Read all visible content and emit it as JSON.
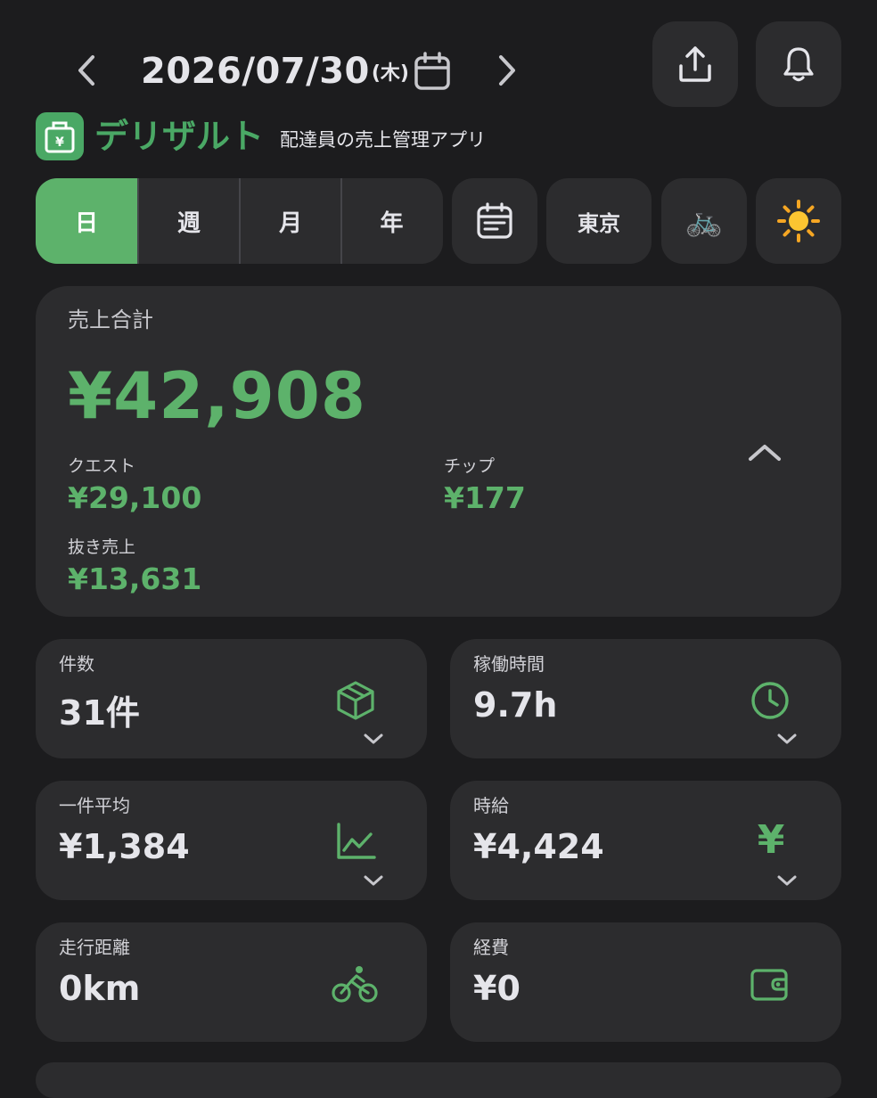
{
  "header": {
    "date": "2026/07/30",
    "weekday": "(木)"
  },
  "brand": {
    "name": "デリザルト",
    "subtitle": "配達員の売上管理アプリ",
    "logo_glyph": "¥"
  },
  "period_tabs": [
    {
      "label": "日",
      "active": true
    },
    {
      "label": "週",
      "active": false
    },
    {
      "label": "月",
      "active": false
    },
    {
      "label": "年",
      "active": false
    }
  ],
  "filters": {
    "region": "東京",
    "vehicle_emoji": "🚲",
    "weather_emoji": "☀️"
  },
  "summary": {
    "title": "売上合計",
    "total": "¥42,908",
    "quest_label": "クエスト",
    "quest_value": "¥29,100",
    "tip_label": "チップ",
    "tip_value": "¥177",
    "net_label": "抜き売上",
    "net_value": "¥13,631"
  },
  "stats": {
    "count": {
      "label": "件数",
      "value": "31件"
    },
    "hours": {
      "label": "稼働時間",
      "value": "9.7h"
    },
    "avg": {
      "label": "一件平均",
      "value": "¥1,384"
    },
    "hourly": {
      "label": "時給",
      "value": "¥4,424",
      "glyph": "¥"
    },
    "distance": {
      "label": "走行距離",
      "value": "0km"
    },
    "expense": {
      "label": "経費",
      "value": "¥0"
    }
  },
  "colors": {
    "accent": "#5db26b",
    "background": "#1c1c1e",
    "card": "#2c2c2e"
  }
}
